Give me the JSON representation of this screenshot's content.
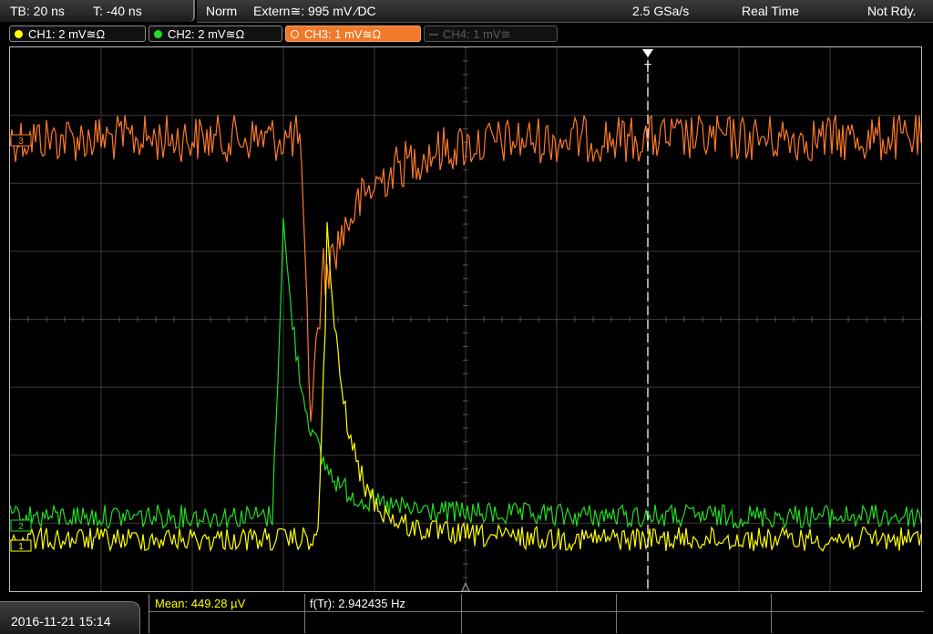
{
  "status_bar": {
    "timebase": "TB: 20 ns",
    "trigger_time": "T: -40 ns",
    "trigger_mode": "Norm",
    "trigger_source": "Extern≅: 995 mV ⁄DC",
    "sample_rate": "2.5 GSa/s",
    "acquisition_mode": "Real Time",
    "trigger_status": "Not Rdy."
  },
  "channels": [
    {
      "id": "ch1",
      "label": "CH1: 2 mV≊Ω",
      "color": "#ffff00",
      "active": true
    },
    {
      "id": "ch2",
      "label": "CH2: 2 mV≊Ω",
      "color": "#22dd22",
      "active": true
    },
    {
      "id": "ch3",
      "label": "CH3: 1 mV≊Ω",
      "color": "#ff7a2a",
      "active": true,
      "selected": true
    },
    {
      "id": "ch4",
      "label": "CH4: 1 mV≊",
      "color": "#555555",
      "active": false
    }
  ],
  "trace_markers": {
    "ch1": "1",
    "ch2": "2",
    "ch3": "3",
    "trigger": "T"
  },
  "measurements": {
    "mean": "Mean: 449.28 µV",
    "frequency": "f(Tr): 2.942435 Hz"
  },
  "timestamp": "2016-11-21 15:14",
  "colors": {
    "ch1": "#ffff00",
    "ch2": "#22dd22",
    "ch3": "#ff7a2a",
    "grid": "#3a3a3a",
    "background": "#000000"
  },
  "chart_data": {
    "type": "line",
    "grid": "10 x 8 divisions",
    "time_per_div_ns": 20,
    "trigger_position_ns": -40,
    "series": [
      {
        "name": "CH1",
        "scale_mV_per_div": 2,
        "description": "yellow noisy baseline, pulse peak ~3.9 div above baseline near x=3.5 div"
      },
      {
        "name": "CH2",
        "scale_mV_per_div": 2,
        "description": "green noisy baseline, sharp pulse peak ~4.4 div above baseline near x=3.0 div"
      },
      {
        "name": "CH3",
        "scale_mV_per_div": 1,
        "description": "orange noisy baseline near top, negative dip ~4 div near x=3.3 div with slow recovery"
      }
    ]
  }
}
